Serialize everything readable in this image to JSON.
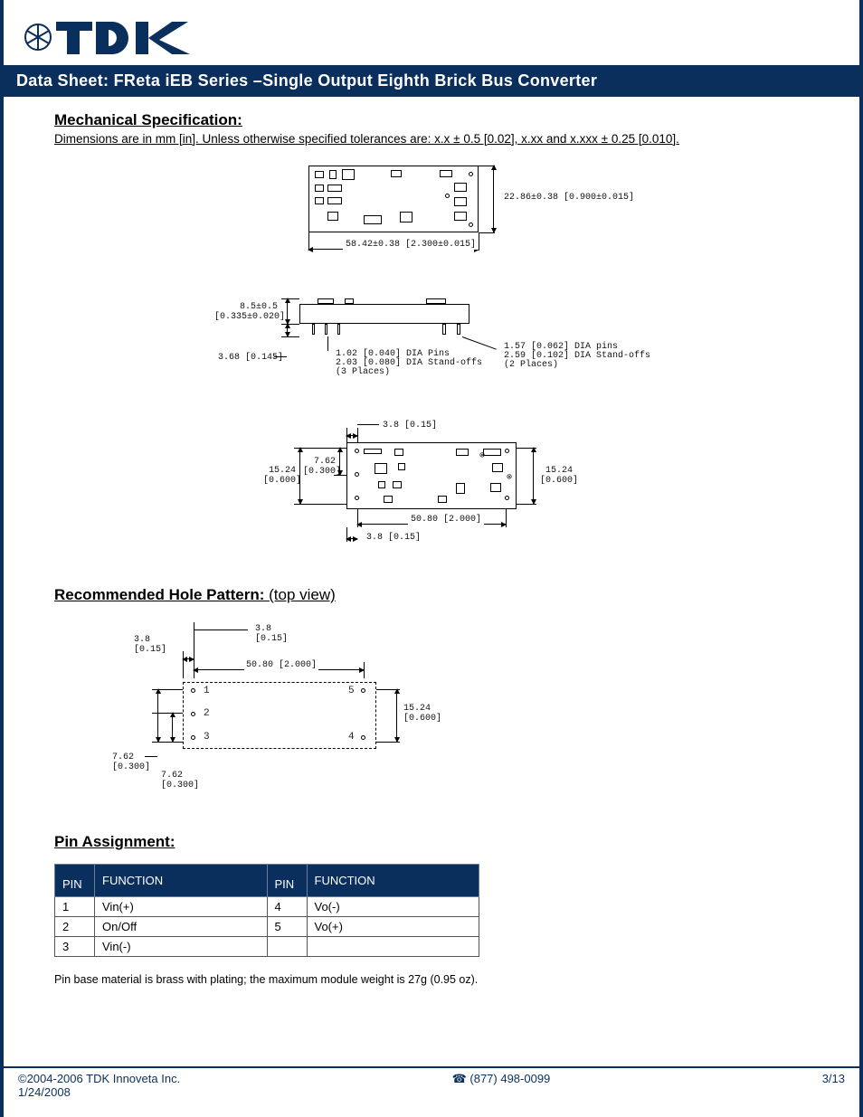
{
  "brand": "TDK",
  "title": "Data Sheet: FReta iEB Series –Single Output Eighth Brick Bus Converter",
  "sections": {
    "mech_head": "Mechanical Specification:",
    "mech_sub": "Dimensions are in mm [in].  Unless otherwise specified tolerances are: x.x ± 0.5 [0.02], x.xx and x.xxx ± 0.25 [0.010].",
    "rec_head": "Recommended Hole Pattern:",
    "rec_paren": "(top view)",
    "pin_head": "Pin Assignment:",
    "note": "Pin base material is brass with plating; the maximum module weight is 27g (0.95 oz)."
  },
  "dims": {
    "top_w": "58.42±0.38 [2.300±0.015]",
    "top_h": "22.86±0.38 [0.900±0.015]",
    "side_h": "8.5±0.5\n[0.335±0.020]",
    "side_pin": "3.68 [0.145]",
    "side_note_l1": "1.02 [0.040] DIA Pins",
    "side_note_l2": "2.03 [0.080] DIA Stand-offs",
    "side_note_l3": "(3 Places)",
    "side_note_r1": "1.57 [0.062] DIA pins",
    "side_note_r2": "2.59 [0.102] DIA Stand-offs",
    "side_note_r3": "(2 Places)",
    "bot_edge": "3.8 [0.15]",
    "bot_edge2": "3.8 [0.15]",
    "bot_762": "7.62\n[0.300]",
    "bot_1524l": "15.24\n[0.600]",
    "bot_1524r": "15.24\n[0.600]",
    "bot_5080": "50.80 [2.000]",
    "hole_38a": "3.8\n[0.15]",
    "hole_38b": "3.8\n[0.15]",
    "hole_5080": "50.80 [2.000]",
    "hole_1524": "15.24\n[0.600]",
    "hole_762a": "7.62\n[0.300]",
    "hole_762b": "7.62\n[0.300]",
    "hole_pins": {
      "p1": "1",
      "p2": "2",
      "p3": "3",
      "p4": "4",
      "p5": "5"
    }
  },
  "pin_table": {
    "headers": {
      "pin": "PIN",
      "func": "FUNCTION"
    },
    "rows": [
      {
        "p": "1",
        "f": "Vin(+)",
        "p2": "4",
        "f2": "Vo(-)"
      },
      {
        "p": "2",
        "f": "On/Off",
        "p2": "5",
        "f2": "Vo(+)"
      },
      {
        "p": "3",
        "f": "Vin(-)",
        "p2": "",
        "f2": ""
      }
    ]
  },
  "footer": {
    "copyright": "©2004-2006  TDK Innoveta Inc.",
    "date": "1/24/2008",
    "phone": "(877) 498-0099",
    "page": "3/13"
  }
}
